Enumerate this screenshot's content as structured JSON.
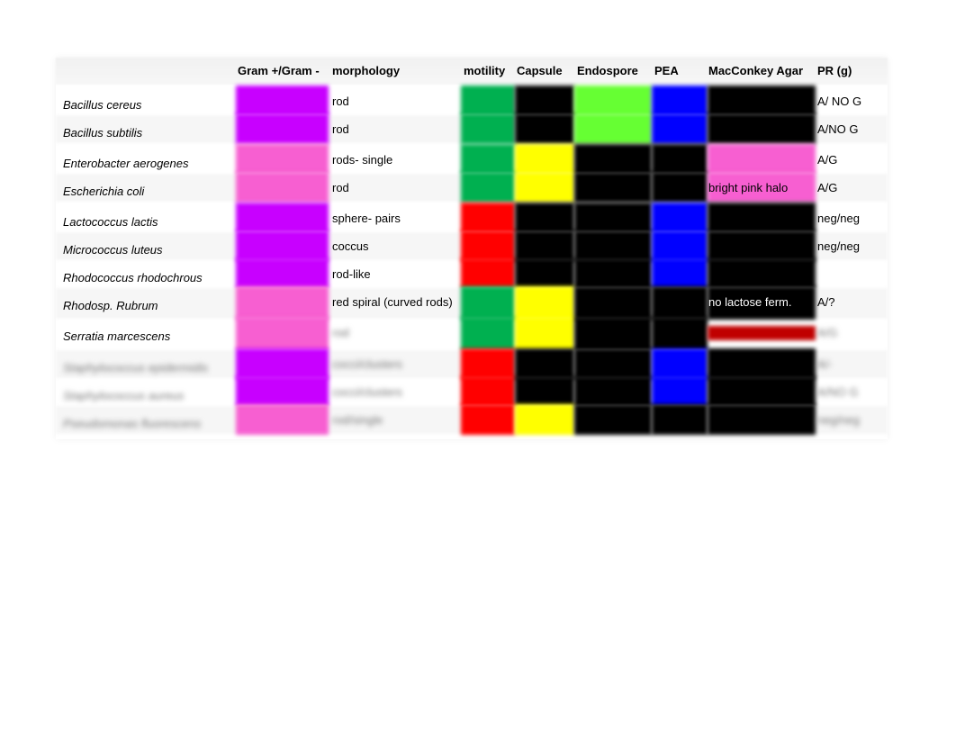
{
  "table": {
    "headers": {
      "species": "",
      "gram": "Gram +/Gram -",
      "morphology": "morphology",
      "motility": "motility",
      "capsule": "Capsule",
      "endospore": "Endospore",
      "pea": "PEA",
      "macconkey": "MacConkey Agar",
      "pr": "PR  (g)"
    },
    "colors": {
      "purple": "#c800ff",
      "pink": "#f75fd1",
      "green": "#00b050",
      "lime": "#66ff33",
      "yellow": "#ffff00",
      "red": "#ff0000",
      "blue": "#0000ff",
      "black": "#000000",
      "dark_red": "#c00000"
    },
    "rows": [
      {
        "species": "Bacillus cereus",
        "gram": "purple",
        "morphology": "rod",
        "motility": "green",
        "capsule": "black",
        "endospore": "lime",
        "pea": "blue",
        "macconkey": "",
        "macconkey_color": "black",
        "pr": "A/ NO G"
      },
      {
        "species": "Bacillus subtilis",
        "gram": "purple",
        "morphology": "rod",
        "motility": "green",
        "capsule": "black",
        "endospore": "lime",
        "pea": "blue",
        "macconkey": "",
        "macconkey_color": "black",
        "pr": "A/NO G"
      },
      {
        "species": "Enterobacter aerogenes",
        "gram": "pink",
        "morphology": "rods- single",
        "motility": "green",
        "capsule": "yellow",
        "endospore": "black",
        "pea": "black",
        "macconkey": "",
        "macconkey_color": "pink",
        "pr": "A/G"
      },
      {
        "species": "Escherichia coli",
        "gram": "pink",
        "morphology": "rod",
        "motility": "green",
        "capsule": "yellow",
        "endospore": "black",
        "pea": "black",
        "macconkey": "bright pink halo",
        "macconkey_color": "pink",
        "pr": "A/G"
      },
      {
        "species": "Lactococcus lactis",
        "gram": "purple",
        "morphology": "sphere- pairs",
        "motility": "red",
        "capsule": "black",
        "endospore": "black",
        "pea": "blue",
        "macconkey": "",
        "macconkey_color": "black",
        "pr": "neg/neg"
      },
      {
        "species": "Micrococcus luteus",
        "gram": "purple",
        "morphology": "coccus",
        "motility": "red",
        "capsule": "black",
        "endospore": "black",
        "pea": "blue",
        "macconkey": "",
        "macconkey_color": "black",
        "pr": "neg/neg"
      },
      {
        "species": "Rhodococcus rhodochrous",
        "gram": "purple",
        "morphology": "rod-like",
        "motility": "red",
        "capsule": "black",
        "endospore": "black",
        "pea": "blue",
        "macconkey": "",
        "macconkey_color": "black",
        "pr": ""
      },
      {
        "species": "Rhodosp. Rubrum",
        "gram": "pink",
        "morphology": "red spiral (curved rods)",
        "motility": "green",
        "capsule": "yellow",
        "endospore": "black",
        "pea": "black",
        "macconkey": "no lactose ferm.",
        "macconkey_color": "black",
        "pr": "A/?"
      },
      {
        "species": "Serratia marcescens",
        "gram": "pink",
        "morphology": "rod",
        "motility": "green",
        "capsule": "yellow",
        "endospore": "black",
        "pea": "black",
        "macconkey": "",
        "macconkey_color": "dark_red",
        "pr": "A/G",
        "blurred_text": true
      },
      {
        "species": "Staphylococcus epidermidis",
        "gram": "purple",
        "morphology": "cocci/clusters",
        "motility": "red",
        "capsule": "black",
        "endospore": "black",
        "pea": "blue",
        "macconkey": "",
        "macconkey_color": "black",
        "pr": "A/-",
        "blurred": true
      },
      {
        "species": "Staphylococcus aureus",
        "gram": "purple",
        "morphology": "cocci/clusters",
        "motility": "red",
        "capsule": "black",
        "endospore": "black",
        "pea": "blue",
        "macconkey": "",
        "macconkey_color": "black",
        "pr": "A/NO G",
        "blurred": true
      },
      {
        "species": "Pseudomonas fluorescens",
        "gram": "pink",
        "morphology": "rod/single",
        "motility": "red",
        "capsule": "yellow",
        "endospore": "black",
        "pea": "black",
        "macconkey": "",
        "macconkey_color": "black",
        "pr": "neg/neg",
        "blurred": true
      }
    ]
  }
}
